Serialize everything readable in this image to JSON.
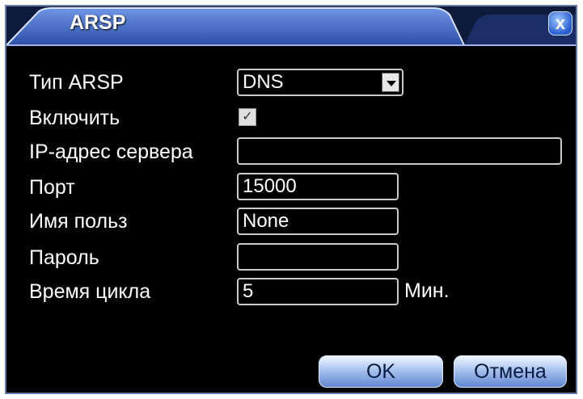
{
  "dialog": {
    "title": "ARSP",
    "close_label": "x"
  },
  "form": {
    "type_label": "Тип ARSP",
    "type_value": "DNS",
    "enable_label": "Включить",
    "enable_checked": true,
    "server_label": "IP-адрес сервера",
    "server_value": "",
    "port_label": "Порт",
    "port_value": "15000",
    "username_label": "Имя польз",
    "username_value": "None",
    "password_label": "Пароль",
    "password_value": "",
    "cycle_label": "Время цикла",
    "cycle_value": "5",
    "cycle_unit": "Мин."
  },
  "buttons": {
    "ok_label": "OK",
    "cancel_label": "Отмена"
  },
  "colors": {
    "title_bar": "#3a5fb8",
    "accent": "#7fa8f0"
  }
}
